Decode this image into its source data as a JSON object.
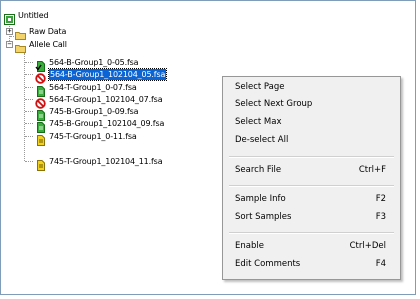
{
  "tree": {
    "root": {
      "label": "Untitled",
      "icon": "project-icon"
    },
    "raw_data": {
      "label": "Raw Data",
      "icon": "folder-icon",
      "expander": "+"
    },
    "allele_call": {
      "label": "Allele Call",
      "icon": "folder-icon",
      "expander": "−"
    },
    "files": [
      {
        "label": "564-B-Group1_0-05.fsa",
        "icon": "green-file-check-icon",
        "selected": false
      },
      {
        "label": "564-B-Group1_102104_05.fsa",
        "icon": "no-entry-icon",
        "selected": true
      },
      {
        "label": "564-T-Group1_0-07.fsa",
        "icon": "green-file-icon",
        "selected": false
      },
      {
        "label": "564-T-Group1_102104_07.fsa",
        "icon": "no-entry-icon",
        "selected": false
      },
      {
        "label": "745-B-Group1_0-09.fsa",
        "icon": "green-file-icon",
        "selected": false
      },
      {
        "label": "745-B-Group1_102104_09.fsa",
        "icon": "green-file-icon",
        "selected": false
      },
      {
        "label": "745-T-Group1_0-11.fsa",
        "icon": "yellow-file-icon",
        "selected": false
      },
      {
        "label": "745-T-Group1_102104_11.fsa",
        "icon": "yellow-file-icon",
        "selected": false
      }
    ]
  },
  "context_menu": {
    "items": [
      {
        "label": "Select Page",
        "shortcut": ""
      },
      {
        "label": "Select Next Group",
        "shortcut": ""
      },
      {
        "label": "Select Max",
        "shortcut": ""
      },
      {
        "label": "De-select All",
        "shortcut": ""
      },
      {
        "label": "Search File",
        "shortcut": "Ctrl+F"
      },
      {
        "label": "Sample Info",
        "shortcut": "F2"
      },
      {
        "label": "Sort Samples",
        "shortcut": "F3"
      },
      {
        "label": "Enable",
        "shortcut": "Ctrl+Del"
      },
      {
        "label": "Edit Comments",
        "shortcut": "F4"
      }
    ]
  },
  "colors": {
    "selection": "#0a64d6",
    "green_file": "#2fa82f",
    "yellow_file": "#e8c200",
    "no_entry": "#d01010",
    "folder": "#f3d36b"
  }
}
